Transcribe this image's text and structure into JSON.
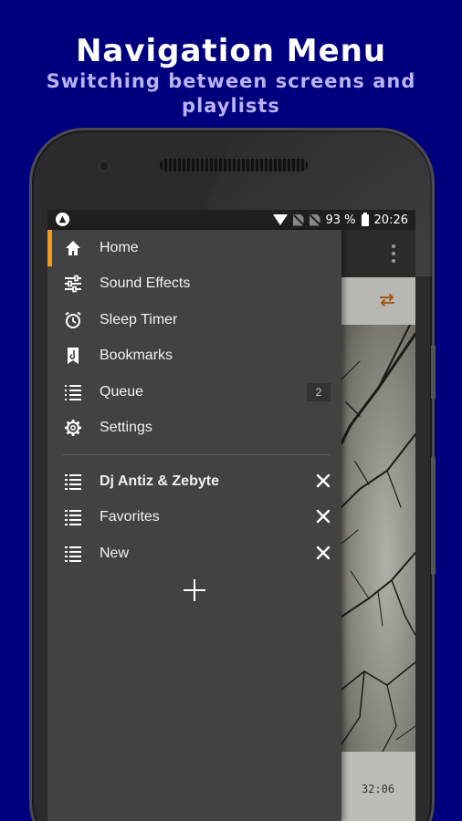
{
  "promo": {
    "title": "Navigation Menu",
    "subtitle": "Switching between screens and playlists"
  },
  "status_bar": {
    "battery_text": "93 %",
    "time": "20:26"
  },
  "menu": {
    "items": [
      {
        "label": "Home",
        "icon": "home-icon",
        "active": true
      },
      {
        "label": "Sound Effects",
        "icon": "equalizer-icon"
      },
      {
        "label": "Sleep Timer",
        "icon": "alarm-icon"
      },
      {
        "label": "Bookmarks",
        "icon": "bookmark-icon"
      },
      {
        "label": "Queue",
        "icon": "queue-list-icon",
        "count": "2"
      },
      {
        "label": "Settings",
        "icon": "gear-icon"
      }
    ]
  },
  "playlists": {
    "items": [
      {
        "label": "Dj Antiz & Zebyte",
        "icon": "playlist-icon",
        "current": true
      },
      {
        "label": "Favorites",
        "icon": "playlist-icon"
      },
      {
        "label": "New",
        "icon": "playlist-icon"
      }
    ],
    "add_icon": "plus-icon"
  },
  "player": {
    "time": "32:06",
    "repeat_icon": "repeat-icon"
  },
  "colors": {
    "background": "#00007f",
    "accent": "#f39a1a",
    "drawer": "#424242"
  }
}
